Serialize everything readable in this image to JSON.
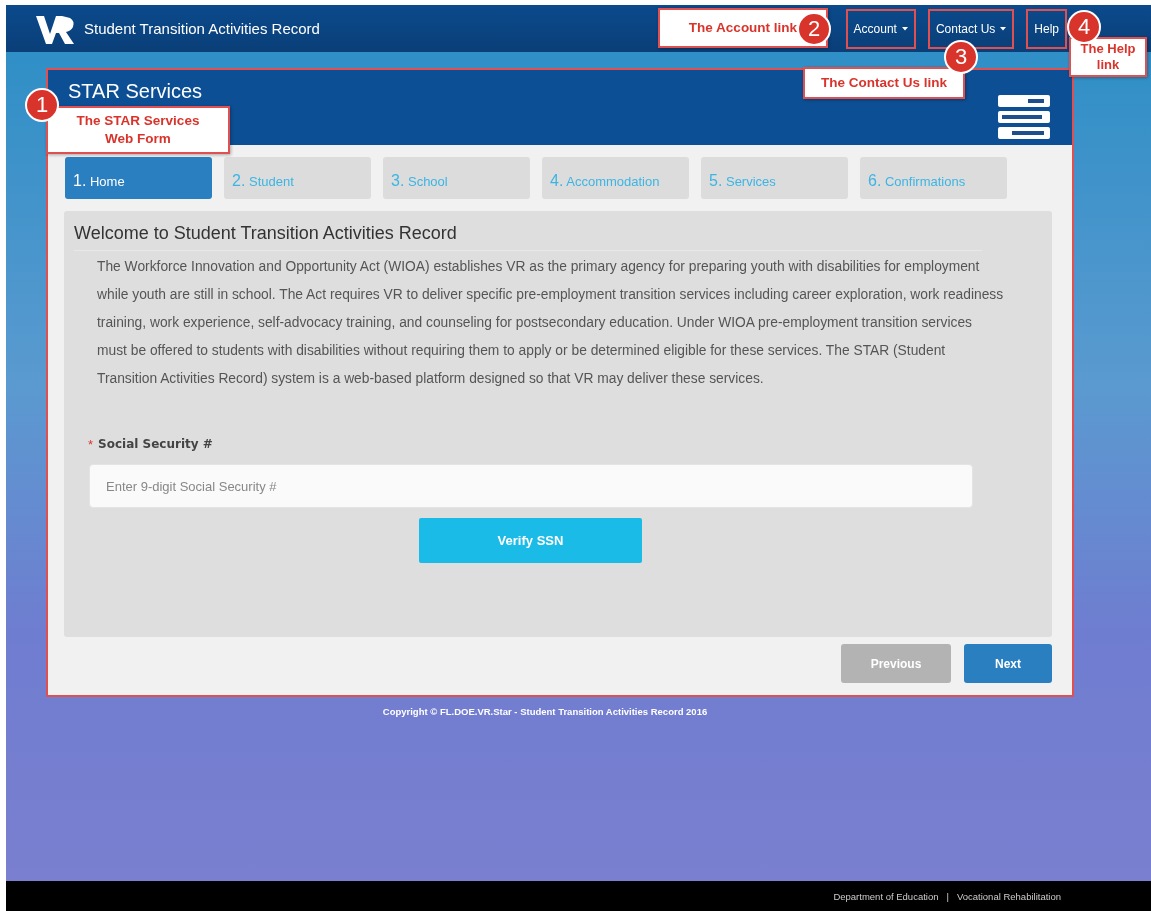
{
  "navbar": {
    "title": "Student Transition Activities Record",
    "links": [
      {
        "label": "Account",
        "dropdown": true,
        "outlined": true
      },
      {
        "label": "Contact Us",
        "dropdown": true,
        "outlined": true
      },
      {
        "label": "Help",
        "dropdown": false,
        "outlined": true
      }
    ]
  },
  "panel": {
    "title": "STAR Services",
    "outlined": true,
    "steps": [
      {
        "number": "1.",
        "label": "Home",
        "selected": true
      },
      {
        "number": "2.",
        "label": "Student",
        "selected": false
      },
      {
        "number": "3.",
        "label": "School",
        "selected": false
      },
      {
        "number": "4.",
        "label": "Accommodation",
        "selected": false
      },
      {
        "number": "5.",
        "label": "Services",
        "selected": false
      },
      {
        "number": "6.",
        "label": "Confirmations",
        "selected": false
      }
    ],
    "heading": "Welcome to Student Transition Activities Record",
    "intro": "The Workforce Innovation and Opportunity Act (WIOA) establishes VR as the primary agency for preparing youth with disabilities for employment while youth are still in school. The Act requires VR to deliver specific pre-employment transition services including career exploration, work readiness training, work experience, self-advocacy training, and counseling for postsecondary education. Under WIOA pre-employment transition services must be offered to students with disabilities without requiring them to apply or be determined eligible for these services. The STAR (Student Transition Activities Record) system is a web-based platform designed so that VR may deliver these services.",
    "ssn_field": {
      "required_mark": "*",
      "label": "Social Security #",
      "placeholder": "Enter 9-digit Social Security #"
    },
    "verify_button": "Verify SSN",
    "buttons": [
      {
        "label": "Previous",
        "disabled": true
      },
      {
        "label": "Next",
        "disabled": false
      }
    ]
  },
  "copyright": "Copyright © FL.DOE.VR.Star - Student Transition Activities Record 2016",
  "footer": {
    "links": [
      "Department of Education",
      "Vocational Rehabilitation"
    ],
    "separator": "|"
  },
  "annotations": [
    {
      "number": "1",
      "label": "The STAR Services Web Form"
    },
    {
      "number": "2",
      "label": "The Account link"
    },
    {
      "number": "3",
      "label": "The Contact Us link"
    },
    {
      "number": "4",
      "label": "The Help link"
    }
  ]
}
